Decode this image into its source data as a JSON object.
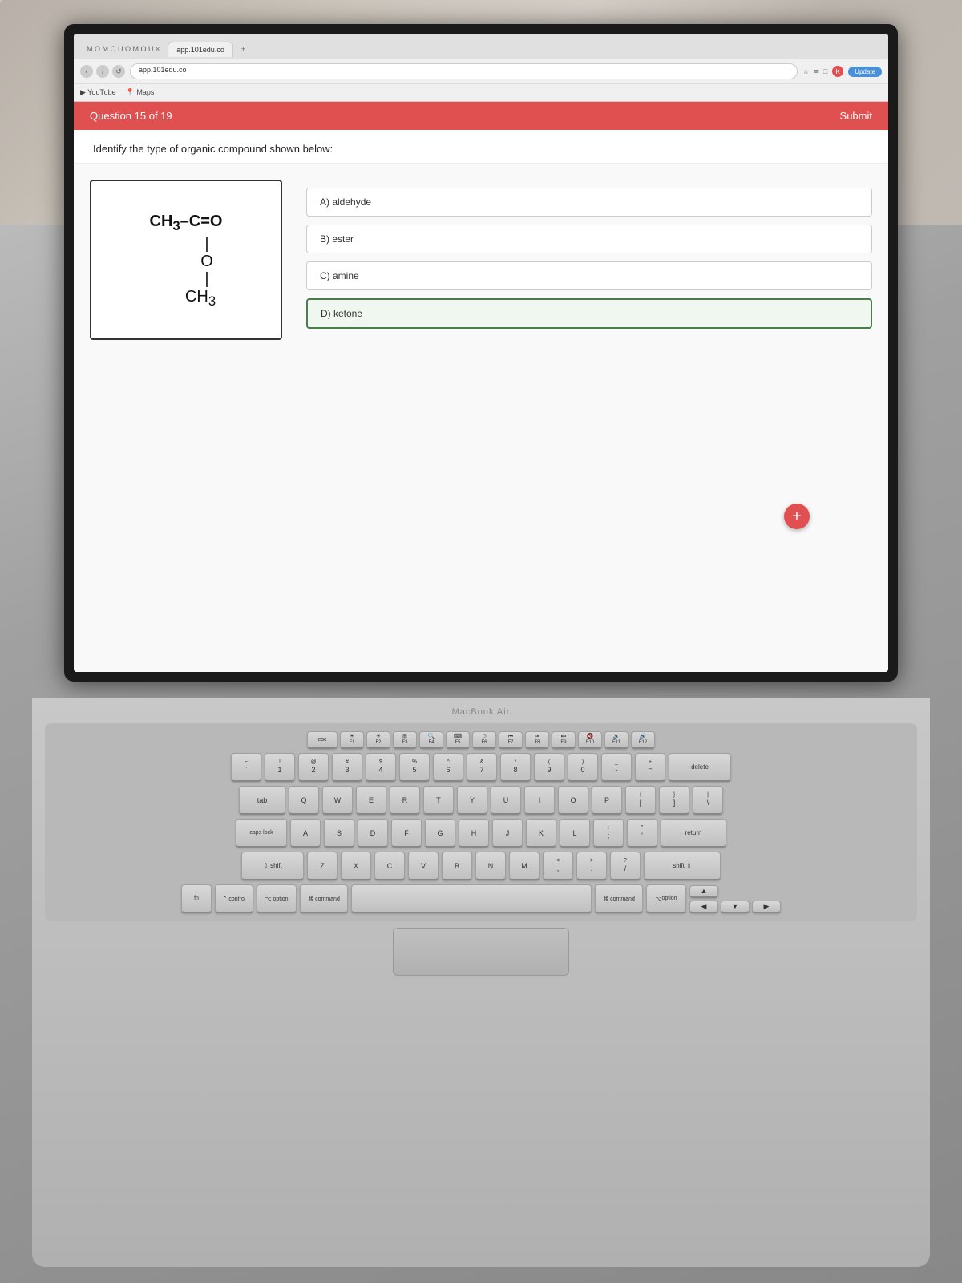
{
  "browser": {
    "url": "app.101edu.co",
    "tabs": [
      {
        "label": "M O M O U O M O U",
        "active": false
      },
      {
        "label": "app.101edu.co",
        "active": true
      }
    ],
    "bookmarks": [
      "YouTube",
      "Maps"
    ],
    "update_label": "Update"
  },
  "quiz": {
    "question_number": "Question 15 of 19",
    "question_text": "Identify the type of organic compound shown below:",
    "submit_label": "Submit",
    "compound": {
      "formula_line1": "CH₃–C=O",
      "formula_line2": "|",
      "formula_line3": "O",
      "formula_line4": "|",
      "formula_line5": "CH₃"
    },
    "answers": [
      {
        "id": "A",
        "label": "A) aldehyde",
        "selected": false
      },
      {
        "id": "B",
        "label": "B) ester",
        "selected": false
      },
      {
        "id": "C",
        "label": "C) amine",
        "selected": false
      },
      {
        "id": "D",
        "label": "D) ketone",
        "selected": true
      }
    ]
  },
  "keyboard": {
    "macbook_label": "MacBook Air",
    "fn_row": [
      "esc",
      "F1",
      "F2",
      "F3",
      "F4",
      "F5",
      "F6",
      "F7",
      "F8",
      "F9",
      "F10",
      "F11",
      "F12"
    ],
    "row1": [
      {
        "top": "!",
        "bottom": "1"
      },
      {
        "top": "@",
        "bottom": "2"
      },
      {
        "top": "#",
        "bottom": "3"
      },
      {
        "top": "$",
        "bottom": "4"
      },
      {
        "top": "%",
        "bottom": "5"
      },
      {
        "top": "^",
        "bottom": "6"
      },
      {
        "top": "&",
        "bottom": "7"
      },
      {
        "top": "*",
        "bottom": "8"
      },
      {
        "top": "(",
        "bottom": "9"
      },
      {
        "top": ")",
        "bottom": "0"
      },
      {
        "top": "_",
        "bottom": "-"
      },
      {
        "top": "+",
        "bottom": "="
      }
    ],
    "row2_letters": [
      "Q",
      "W",
      "E",
      "R",
      "T",
      "Y",
      "U",
      "I",
      "O",
      "P"
    ],
    "row3_letters": [
      "A",
      "S",
      "D",
      "F",
      "G",
      "H",
      "J",
      "K",
      "L"
    ],
    "row4_letters": [
      "Z",
      "X",
      "C",
      "V",
      "B",
      "N",
      "M"
    ],
    "bottom_keys": {
      "ctrl": "control",
      "option_left": "option",
      "cmd_left": "command",
      "space": "",
      "cmd_right": "command",
      "option_right": "option"
    }
  },
  "icons": {
    "plus": "+",
    "back_arrow": "‹",
    "forward_arrow": "›",
    "reload": "↺"
  }
}
